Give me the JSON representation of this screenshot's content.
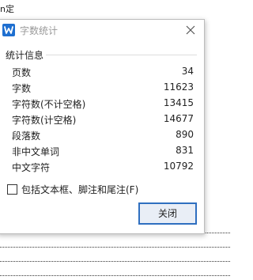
{
  "document": {
    "fragment_text": "n定"
  },
  "dialog": {
    "title": "字数统计",
    "group_title": "统计信息",
    "stats": [
      {
        "label": "页数",
        "value": "34"
      },
      {
        "label": "字数",
        "value": "11623"
      },
      {
        "label": "字符数(不计空格)",
        "value": "13415"
      },
      {
        "label": "字符数(计空格)",
        "value": "14677"
      },
      {
        "label": "段落数",
        "value": "890"
      },
      {
        "label": "非中文单词",
        "value": "831"
      },
      {
        "label": "中文字符",
        "value": "10792"
      }
    ],
    "checkbox": {
      "label": "包括文本框、脚注和尾注(F)",
      "checked": false
    },
    "close_button_label": "关闭",
    "icons": {
      "app": "wps-writer-icon",
      "close": "close-icon"
    },
    "colors": {
      "accent": "#2f6fc0",
      "app_icon": "#1e6fd0"
    }
  }
}
